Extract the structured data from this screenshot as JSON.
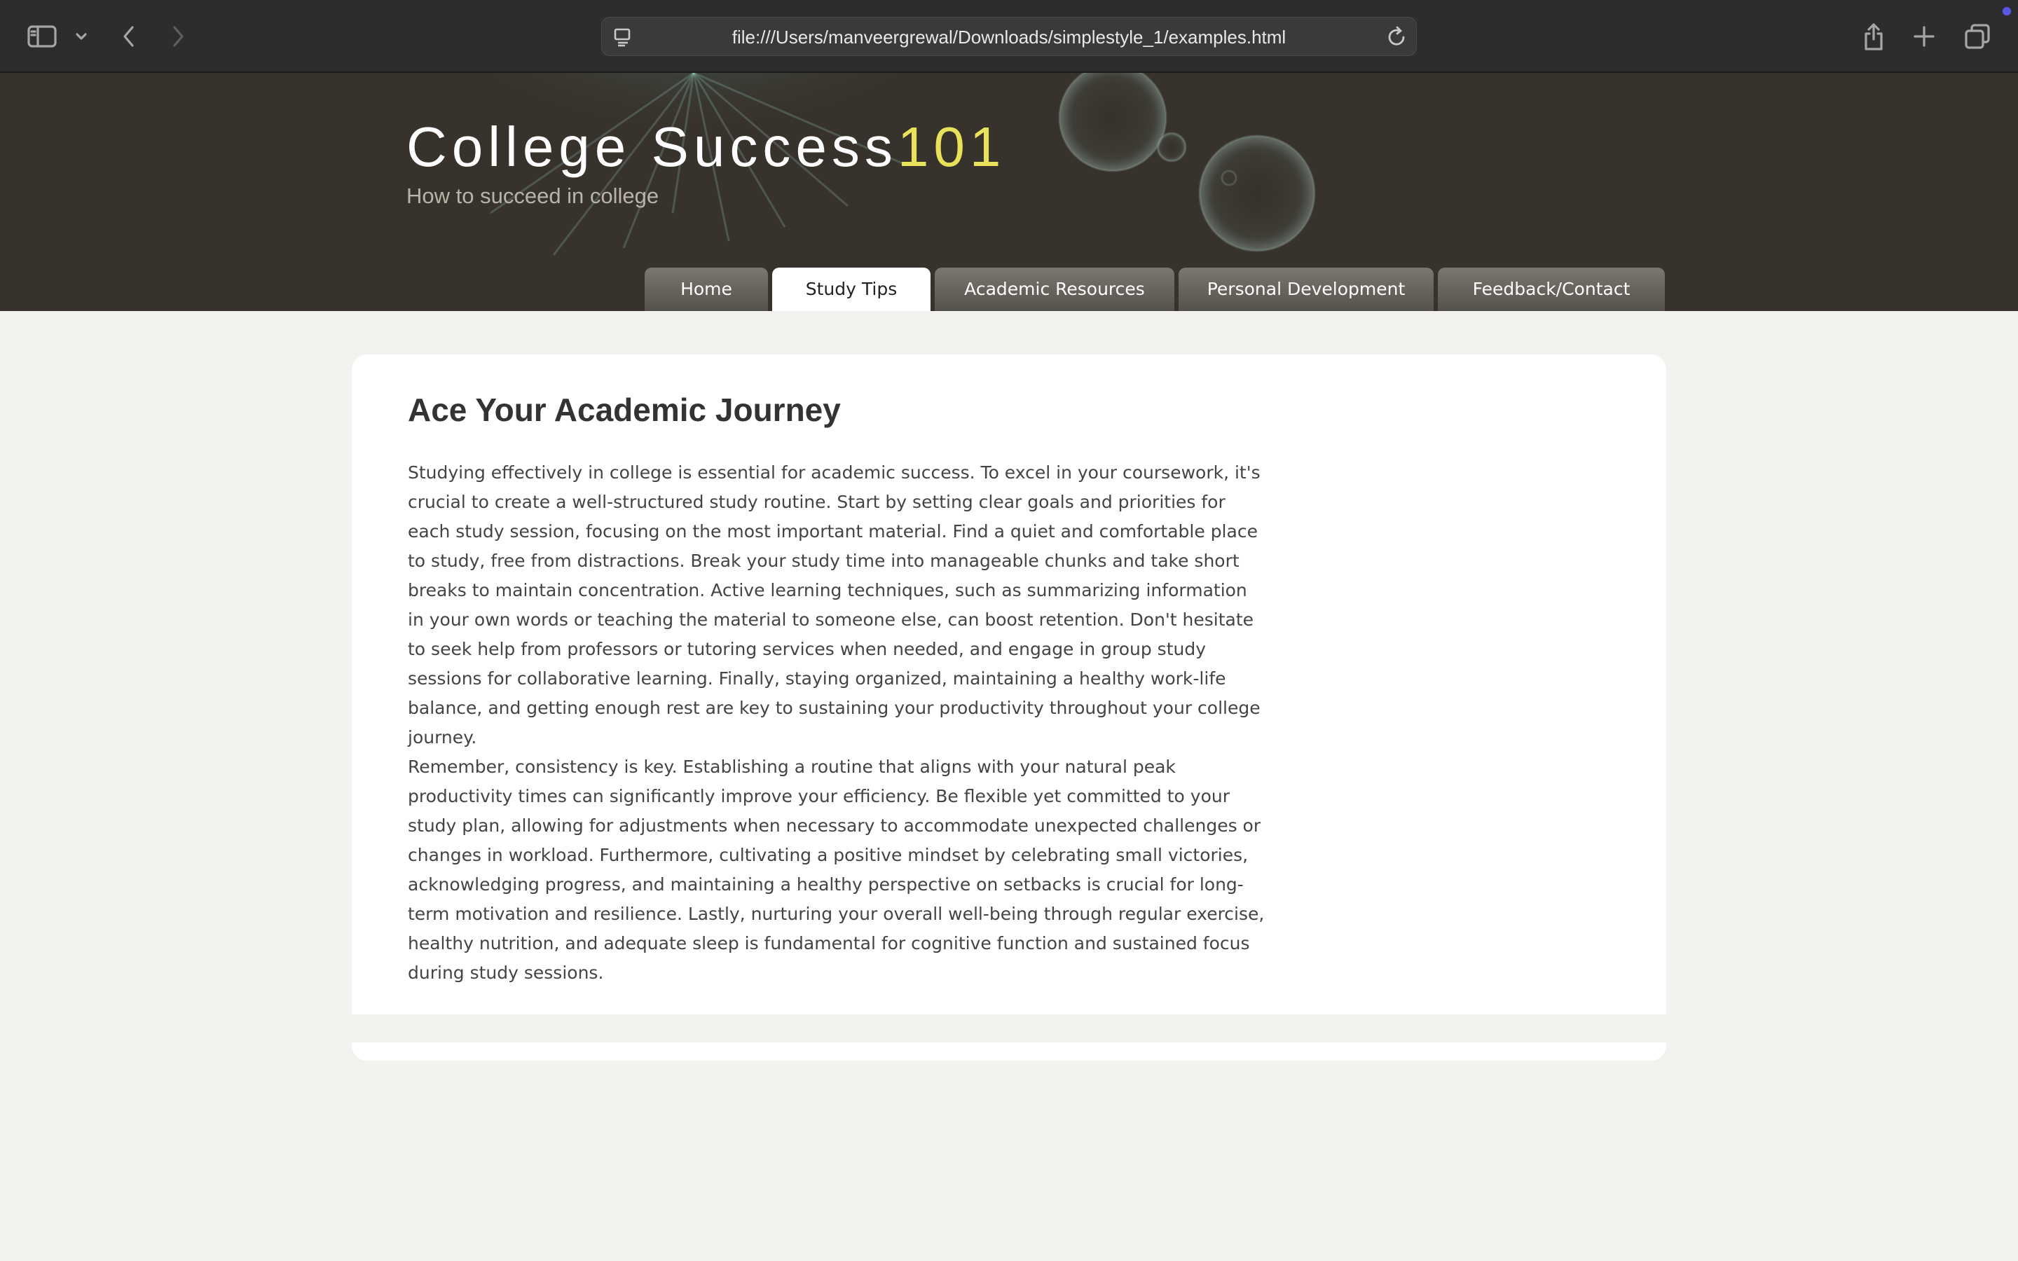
{
  "browser": {
    "url": "file:///Users/manveergrewal/Downloads/simplestyle_1/examples.html",
    "icons": [
      "sidebar-icon",
      "chevron-down-icon",
      "back-arrow-icon",
      "forward-arrow-icon",
      "page-icon",
      "reload-icon",
      "share-icon",
      "new-tab-icon",
      "tab-overview-icon"
    ]
  },
  "header": {
    "title": "College Success",
    "title_accent": "101",
    "slogan": "How to succeed in college"
  },
  "nav": {
    "tabs": [
      {
        "label": "Home",
        "active": false
      },
      {
        "label": "Study Tips",
        "active": true
      },
      {
        "label": "Academic Resources",
        "active": false
      },
      {
        "label": "Personal Development",
        "active": false
      },
      {
        "label": "Feedback/Contact",
        "active": false
      }
    ]
  },
  "main": {
    "heading": "Ace Your Academic Journey",
    "paragraphs": [
      "Studying effectively in college is essential for academic success. To excel in your coursework, it's crucial to create a well-structured study routine. Start by setting clear goals and priorities for each study session, focusing on the most important material. Find a quiet and comfortable place to study, free from distractions. Break your study time into manageable chunks and take short breaks to maintain concentration. Active learning techniques, such as summarizing information in your own words or teaching the material to someone else, can boost retention. Don't hesitate to seek help from professors or tutoring services when needed, and engage in group study sessions for collaborative learning. Finally, staying organized, maintaining a healthy work-life balance, and getting enough rest are key to sustaining your productivity throughout your college journey.",
      "Remember, consistency is key. Establishing a routine that aligns with your natural peak productivity times can significantly improve your efficiency. Be flexible yet committed to your study plan, allowing for adjustments when necessary to accommodate unexpected challenges or changes in workload. Furthermore, cultivating a positive mindset by celebrating small victories, acknowledging progress, and maintaining a healthy perspective on setbacks is crucial for long-term motivation and resilience. Lastly, nurturing your overall well-being through regular exercise, healthy nutrition, and adequate sleep is fundamental for cognitive function and sustained focus during study sessions."
    ]
  },
  "colors": {
    "header_bg": "#38322c",
    "title_accent": "#e8e25a",
    "page_bg": "#f2f2ee",
    "card_bg": "#ffffff"
  }
}
